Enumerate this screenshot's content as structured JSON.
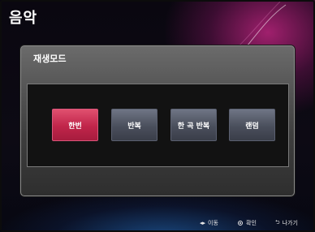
{
  "app": {
    "title": "음악"
  },
  "dialog": {
    "title": "재생모드",
    "options": [
      {
        "label": "한번",
        "selected": true
      },
      {
        "label": "반복",
        "selected": false
      },
      {
        "label": "한 곡 반복",
        "selected": false
      },
      {
        "label": "랜덤",
        "selected": false
      }
    ]
  },
  "hints": {
    "move": {
      "icon": "left-right-arrows-icon",
      "glyph": "◂▸",
      "label": "이동"
    },
    "ok": {
      "icon": "ok-button-icon",
      "label": "확인"
    },
    "exit": {
      "icon": "return-arrow-icon",
      "glyph": "⮌",
      "label": "나가기"
    }
  },
  "colors": {
    "selected_option": "#c0254a",
    "unselected_option": "#4a4f5c",
    "accent_glow": "#d2288c"
  }
}
